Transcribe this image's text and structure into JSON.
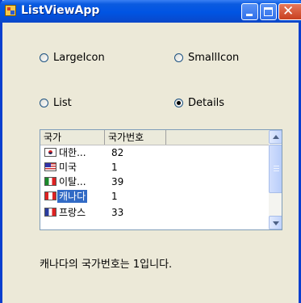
{
  "window": {
    "title": "ListViewApp"
  },
  "view_options": [
    {
      "label": "LargeIcon",
      "checked": false
    },
    {
      "label": "SmallIcon",
      "checked": false
    },
    {
      "label": "List",
      "checked": false
    },
    {
      "label": "Details",
      "checked": true
    }
  ],
  "listview": {
    "columns": [
      "국가",
      "국가번호"
    ],
    "rows": [
      {
        "flag": "flag-korea-icon",
        "name": "대한...",
        "code": "82",
        "selected": false
      },
      {
        "flag": "flag-usa-icon",
        "name": "미국",
        "code": "1",
        "selected": false
      },
      {
        "flag": "flag-italy-icon",
        "name": "이탈...",
        "code": "39",
        "selected": false
      },
      {
        "flag": "flag-canada-icon",
        "name": "캐나다",
        "code": "1",
        "selected": true
      },
      {
        "flag": "flag-france-icon",
        "name": "프랑스",
        "code": "33",
        "selected": false
      }
    ]
  },
  "status": {
    "text": "캐나다의 국가번호는 1입니다."
  },
  "colors": {
    "titlebar": "#0054e3",
    "window_bg": "#ece9d8",
    "selection": "#316ac5"
  }
}
